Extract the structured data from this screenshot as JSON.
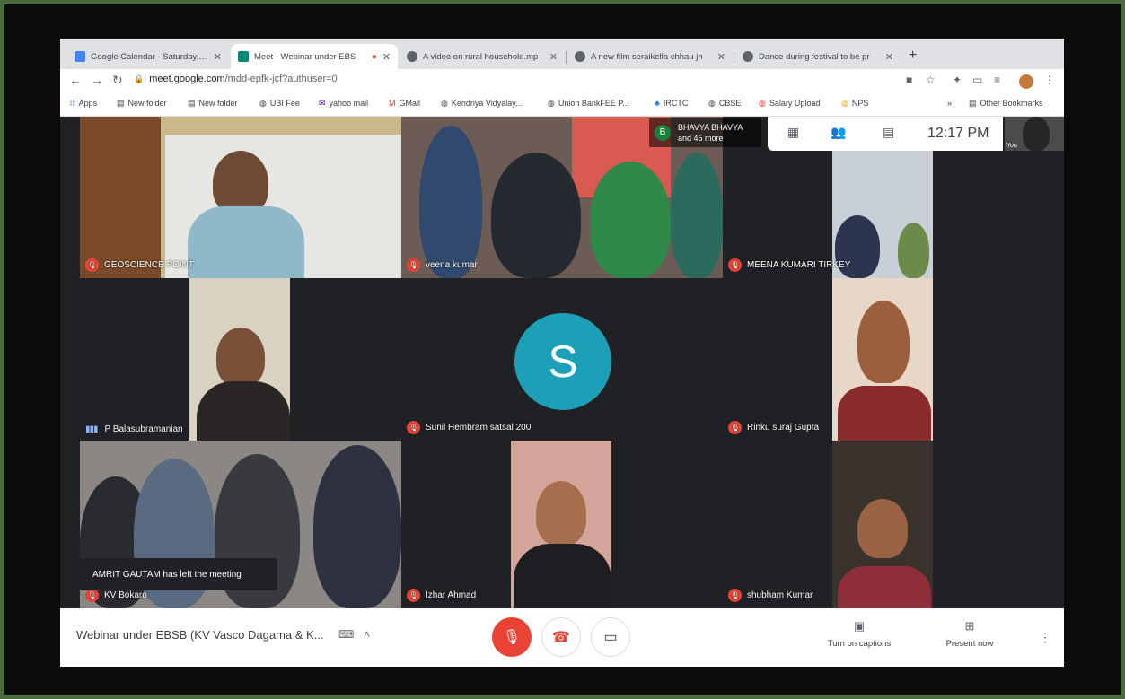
{
  "browser": {
    "tabs": [
      {
        "title": "Google Calendar - Saturday, J...",
        "favicon": "calendar-icon",
        "active": false
      },
      {
        "title": "Meet - Webinar under EBS",
        "favicon": "meet-icon",
        "active": true
      },
      {
        "title": "A video on rural household.mp",
        "favicon": "globe-icon",
        "active": false
      },
      {
        "title": "A new film seraikella chhau jh",
        "favicon": "globe-icon",
        "active": false
      },
      {
        "title": "Dance during festival to be pr",
        "favicon": "globe-icon",
        "active": false
      }
    ],
    "new_tab": "+",
    "url_host": "meet.google.com",
    "url_path": "/mdd-epfk-jcf?authuser=0",
    "bookmarks": [
      {
        "label": "Apps",
        "icon": "apps-grid-icon"
      },
      {
        "label": "New folder",
        "icon": "folder-icon"
      },
      {
        "label": "New folder",
        "icon": "folder-icon"
      },
      {
        "label": "UBI Fee",
        "icon": "globe-icon"
      },
      {
        "label": "yahoo mail",
        "icon": "mail-icon"
      },
      {
        "label": "GMail",
        "icon": "gmail-icon"
      },
      {
        "label": "Kendriya Vidyalay...",
        "icon": "globe-icon"
      },
      {
        "label": "Union BankFEE P...",
        "icon": "globe-icon"
      },
      {
        "label": "IRCTC",
        "icon": "globe-icon"
      },
      {
        "label": "CBSE",
        "icon": "globe-icon"
      },
      {
        "label": "Salary Upload",
        "icon": "globe-icon"
      },
      {
        "label": "NPS",
        "icon": "globe-icon"
      }
    ],
    "other_bookmarks": "Other Bookmarks"
  },
  "meet": {
    "clock": "12:17 PM",
    "others": {
      "initial": "B",
      "line1": "BHAVYA BHAVYA",
      "line2": "and 45 more"
    },
    "you_label": "You",
    "participants": [
      {
        "name": "GEOSCIENCE POINT",
        "muted": true
      },
      {
        "name": "veena kumar",
        "muted": true
      },
      {
        "name": "MEENA KUMARI TIRKEY",
        "muted": true
      },
      {
        "name": "P Balasubramanian",
        "muted": false
      },
      {
        "name": "Sunil Hembram satsal 200",
        "muted": true,
        "avatar": "S",
        "avatar_color": "#1ba0b8"
      },
      {
        "name": "Rinku suraj Gupta",
        "muted": true
      },
      {
        "name": "KV Bokaro",
        "muted": true
      },
      {
        "name": "Izhar Ahmad",
        "muted": true
      },
      {
        "name": "shubham Kumar",
        "muted": true
      }
    ],
    "toast": "AMRIT GAUTAM has left the meeting",
    "meeting_title": "Webinar under EBSB (KV Vasco Dagama & K...",
    "captions_label": "Turn on captions",
    "present_label": "Present now"
  },
  "colors": {
    "mute_red": "#ea4335",
    "avatar_teal": "#1ba0b8",
    "stage": "#202124"
  }
}
